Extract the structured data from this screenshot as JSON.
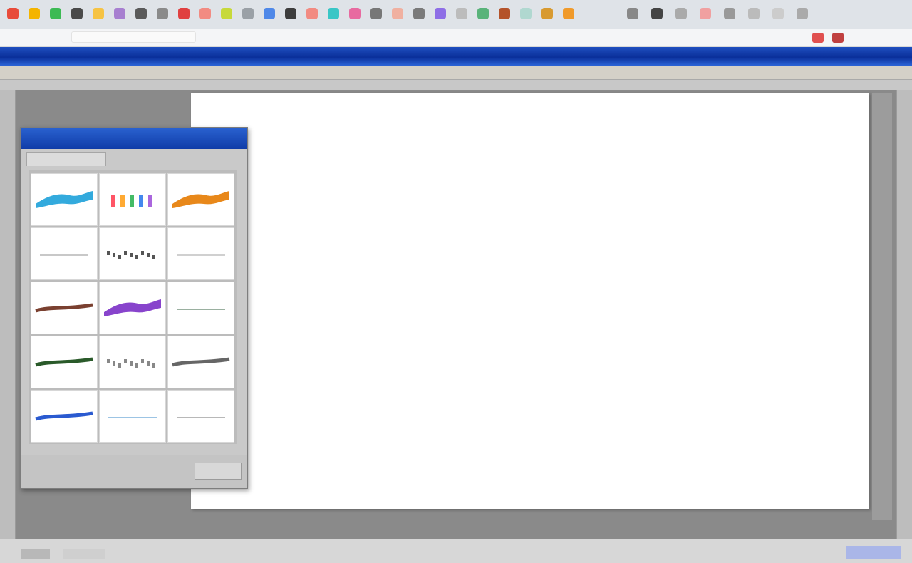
{
  "browser": {
    "favicon_colors": [
      "#e84b3a",
      "#f4b400",
      "#3cba54",
      "#4a4a4a",
      "#f6c343",
      "#a77fd0",
      "#5a5a5a",
      "#8a8a8a",
      "#e04040",
      "#f28b82",
      "#c7d93a",
      "#9aa0a6",
      "#4f88e8",
      "#3d3d3d",
      "#f28b82",
      "#39c6c6",
      "#e86aa0",
      "#777777",
      "#f0b0a0",
      "#7a7a7a",
      "#8e6ee6",
      "#bcbcbc",
      "#59b37a",
      "#b4532a",
      "#b0d8d0",
      "#d89a30",
      "#f09a2a",
      "#888888",
      "#444444",
      "#aaaaaa",
      "#f0a0a0",
      "#999999",
      "#bbbbbb",
      "#cccccc",
      "#aaaaaa"
    ],
    "toolbar_icon_colors": [
      "#e05050",
      "#c04040"
    ]
  },
  "app": {
    "accent": "#1f4fbf"
  },
  "dialog": {
    "accent": "#2a62d0",
    "style_cells": [
      {
        "name": "style-blue-gradient",
        "color": "#33aadd",
        "kind": "band"
      },
      {
        "name": "style-rainbow",
        "color": "#ff5566",
        "kind": "rainbow"
      },
      {
        "name": "style-orange-flame",
        "color": "#e8881a",
        "kind": "band"
      },
      {
        "name": "style-light-gray",
        "color": "#c8c8c8",
        "kind": "thin"
      },
      {
        "name": "style-dark-outline",
        "color": "#555555",
        "kind": "dots"
      },
      {
        "name": "style-pale-gray",
        "color": "#d0d0d0",
        "kind": "thin"
      },
      {
        "name": "style-brown",
        "color": "#7a4030",
        "kind": "mid"
      },
      {
        "name": "style-purple",
        "color": "#8844cc",
        "kind": "band"
      },
      {
        "name": "style-light-green",
        "color": "#9ab0a0",
        "kind": "thin"
      },
      {
        "name": "style-dark-green",
        "color": "#2a5a2a",
        "kind": "mid"
      },
      {
        "name": "style-gray-sketch",
        "color": "#888888",
        "kind": "dots"
      },
      {
        "name": "style-gray-shadow",
        "color": "#666666",
        "kind": "mid"
      },
      {
        "name": "style-royal-blue",
        "color": "#2a5ad0",
        "kind": "mid"
      },
      {
        "name": "style-light-blue",
        "color": "#9cc4e4",
        "kind": "thin"
      },
      {
        "name": "style-silver",
        "color": "#b8b8b8",
        "kind": "thin"
      }
    ]
  },
  "statusbar": {
    "accent": "#aab6e8"
  }
}
